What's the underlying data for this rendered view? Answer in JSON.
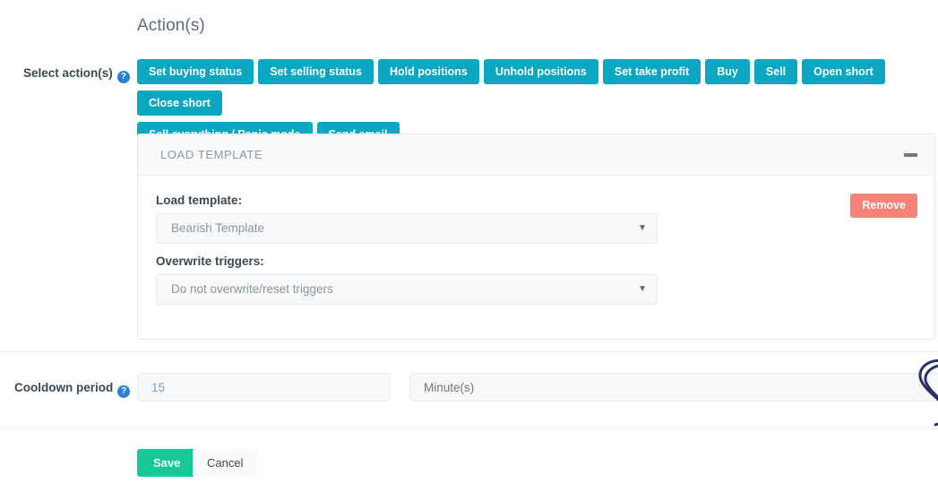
{
  "section": {
    "title": "Action(s)"
  },
  "actions": {
    "label": "Select action(s)",
    "help_icon": "help-circle-icon",
    "buttons": [
      "Set buying status",
      "Set selling status",
      "Hold positions",
      "Unhold positions",
      "Set take profit",
      "Buy",
      "Sell",
      "Open short",
      "Close short",
      "Sell everything / Panic mode",
      "Send email"
    ],
    "button_color": "#0aa7c2"
  },
  "panel": {
    "title": "LOAD TEMPLATE",
    "collapse_icon": "minus-icon",
    "load_template": {
      "label": "Load template:",
      "value": "Bearish Template",
      "caret_icon": "chevron-down-icon"
    },
    "overwrite_triggers": {
      "label": "Overwrite triggers:",
      "value": "Do not overwrite/reset triggers",
      "caret_icon": "chevron-down-icon"
    },
    "remove_label": "Remove",
    "remove_color": "#f58377"
  },
  "cooldown": {
    "label": "Cooldown period",
    "help_icon": "help-circle-icon",
    "value": "15",
    "value_placeholder": "15",
    "unit": "",
    "unit_placeholder": "Minute(s)"
  },
  "footer": {
    "save_label": "Save",
    "save_color": "#17c995",
    "cancel_label": "Cancel"
  },
  "annotation": {
    "name": "hand-drawn-loop-annotation",
    "color": "#2d2f6b"
  }
}
